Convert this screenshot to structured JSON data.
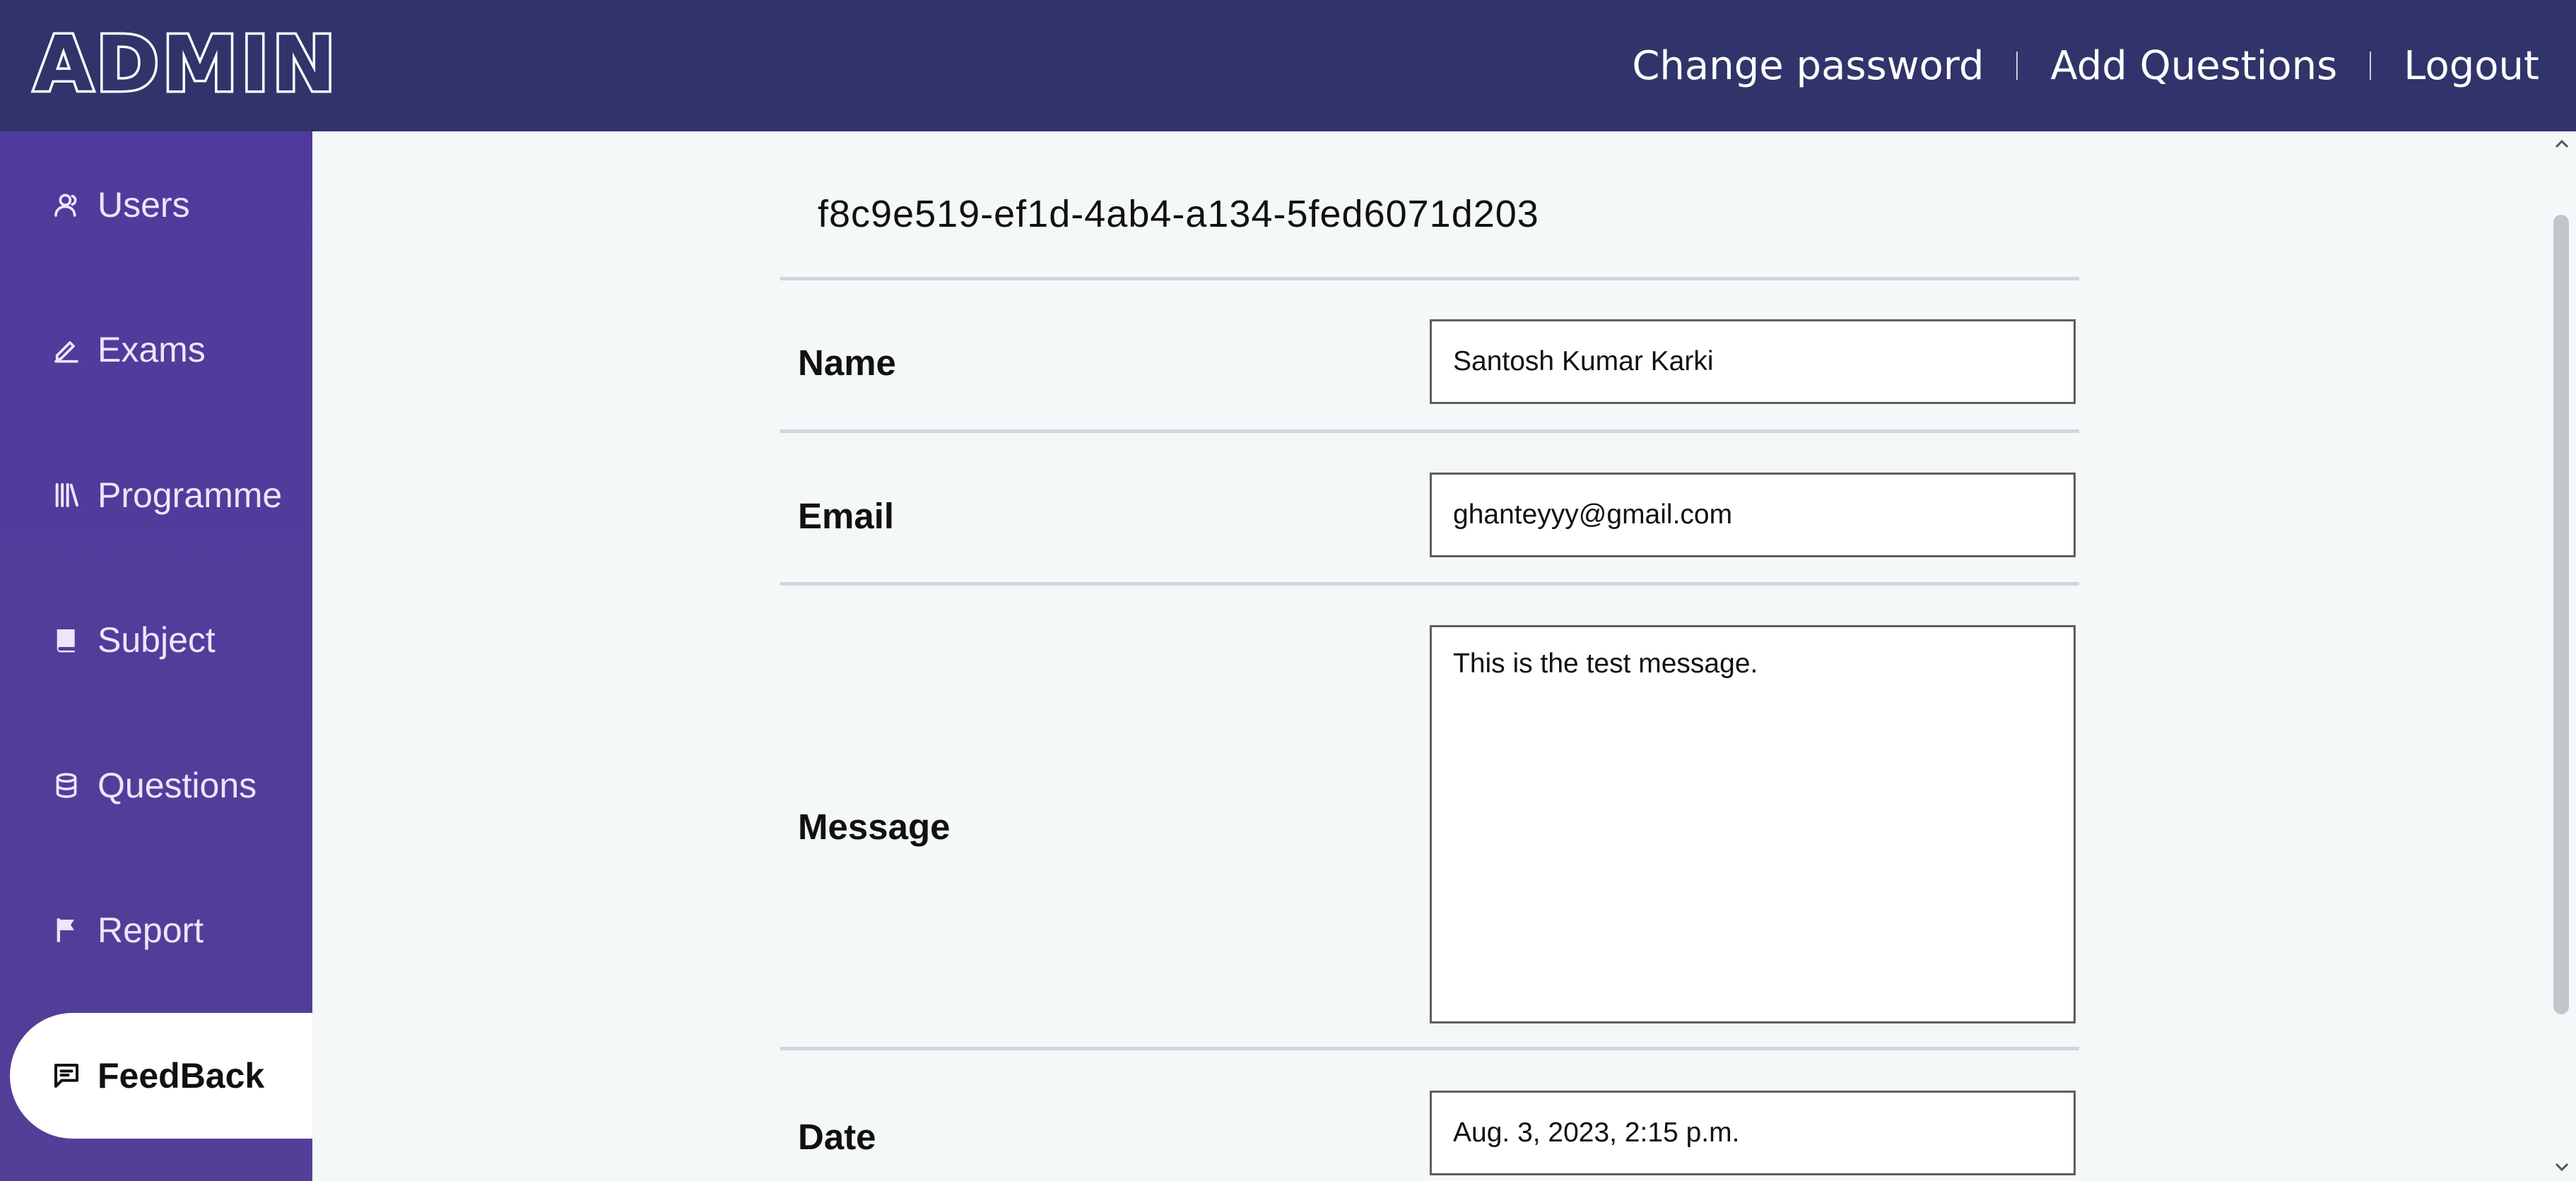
{
  "header": {
    "logo_text": "ADMIN",
    "links": {
      "change_password": "Change password",
      "add_questions": "Add Questions",
      "logout": "Logout"
    }
  },
  "sidebar": {
    "items": [
      {
        "label": "Users",
        "icon": "user-icon"
      },
      {
        "label": "Exams",
        "icon": "pencil-icon"
      },
      {
        "label": "Programme",
        "icon": "library-icon"
      },
      {
        "label": "Subject",
        "icon": "book-icon"
      },
      {
        "label": "Questions",
        "icon": "database-icon"
      },
      {
        "label": "Report",
        "icon": "flag-icon"
      },
      {
        "label": "FeedBack",
        "icon": "message-icon",
        "active": true
      }
    ]
  },
  "feedback": {
    "id": "f8c9e519-ef1d-4ab4-a134-5fed6071d203",
    "name_label": "Name",
    "name_value": "Santosh Kumar Karki",
    "email_label": "Email",
    "email_value": "ghanteyyy@gmail.com",
    "message_label": "Message",
    "message_value": "This is the test message.",
    "date_label": "Date",
    "date_value": "Aug. 3, 2023, 2:15 p.m."
  },
  "colors": {
    "header_bg": "#31346a",
    "sidebar_bg": "#4f3b9b",
    "content_bg": "#f4f8f9"
  }
}
